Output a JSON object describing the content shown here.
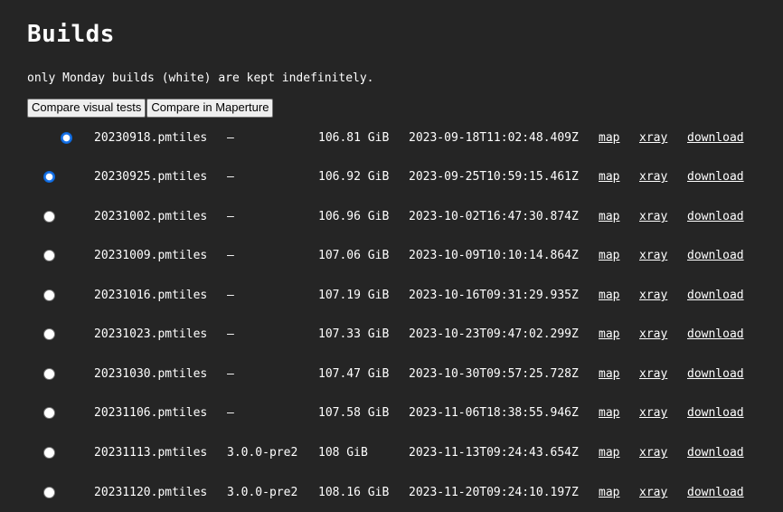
{
  "page": {
    "title": "Builds",
    "note": "only Monday builds (white) are kept indefinitely."
  },
  "toolbar": {
    "compare_visual": "Compare visual tests",
    "compare_maperture": "Compare in Maperture"
  },
  "builds": [
    {
      "file": "20230918.pmtiles",
      "version": "–",
      "size": "106.81 GiB",
      "timestamp": "2023-09-18T11:02:48.409Z",
      "map": "map",
      "xray": "xray",
      "download": "download",
      "selected": true
    },
    {
      "file": "20230925.pmtiles",
      "version": "–",
      "size": "106.92 GiB",
      "timestamp": "2023-09-25T10:59:15.461Z",
      "map": "map",
      "xray": "xray",
      "download": "download",
      "selected": true
    },
    {
      "file": "20231002.pmtiles",
      "version": "–",
      "size": "106.96 GiB",
      "timestamp": "2023-10-02T16:47:30.874Z",
      "map": "map",
      "xray": "xray",
      "download": "download",
      "selected": false
    },
    {
      "file": "20231009.pmtiles",
      "version": "–",
      "size": "107.06 GiB",
      "timestamp": "2023-10-09T10:10:14.864Z",
      "map": "map",
      "xray": "xray",
      "download": "download",
      "selected": false
    },
    {
      "file": "20231016.pmtiles",
      "version": "–",
      "size": "107.19 GiB",
      "timestamp": "2023-10-16T09:31:29.935Z",
      "map": "map",
      "xray": "xray",
      "download": "download",
      "selected": false
    },
    {
      "file": "20231023.pmtiles",
      "version": "–",
      "size": "107.33 GiB",
      "timestamp": "2023-10-23T09:47:02.299Z",
      "map": "map",
      "xray": "xray",
      "download": "download",
      "selected": false
    },
    {
      "file": "20231030.pmtiles",
      "version": "–",
      "size": "107.47 GiB",
      "timestamp": "2023-10-30T09:57:25.728Z",
      "map": "map",
      "xray": "xray",
      "download": "download",
      "selected": false
    },
    {
      "file": "20231106.pmtiles",
      "version": "–",
      "size": "107.58 GiB",
      "timestamp": "2023-11-06T18:38:55.946Z",
      "map": "map",
      "xray": "xray",
      "download": "download",
      "selected": false
    },
    {
      "file": "20231113.pmtiles",
      "version": "3.0.0-pre2",
      "size": "108 GiB",
      "timestamp": "2023-11-13T09:24:43.654Z",
      "map": "map",
      "xray": "xray",
      "download": "download",
      "selected": false
    },
    {
      "file": "20231120.pmtiles",
      "version": "3.0.0-pre2",
      "size": "108.16 GiB",
      "timestamp": "2023-11-20T09:24:10.197Z",
      "map": "map",
      "xray": "xray",
      "download": "download",
      "selected": false
    }
  ]
}
